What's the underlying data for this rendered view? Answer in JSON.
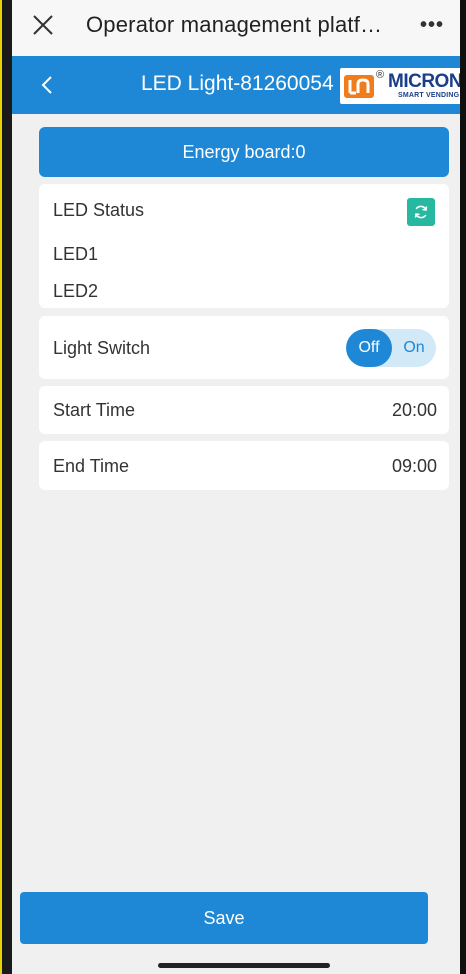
{
  "topbar": {
    "title": "Operator management platf…",
    "more": "•••"
  },
  "header": {
    "title": "LED Light-81260054",
    "logo": {
      "brand": "MICRON",
      "tagline": "SMART VENDING",
      "registered": "®"
    }
  },
  "energy_board": "Energy board:0",
  "led_status": {
    "title": "LED Status",
    "items": [
      "LED1",
      "LED2"
    ]
  },
  "light_switch": {
    "label": "Light Switch",
    "off_label": "Off",
    "on_label": "On",
    "state": "Off"
  },
  "schedule": {
    "start_label": "Start Time",
    "start_value": "20:00",
    "end_label": "End Time",
    "end_value": "09:00"
  },
  "save_label": "Save",
  "colors": {
    "primary": "#1e88d6",
    "refresh": "#26b8a0",
    "background": "#f0f0f0"
  }
}
